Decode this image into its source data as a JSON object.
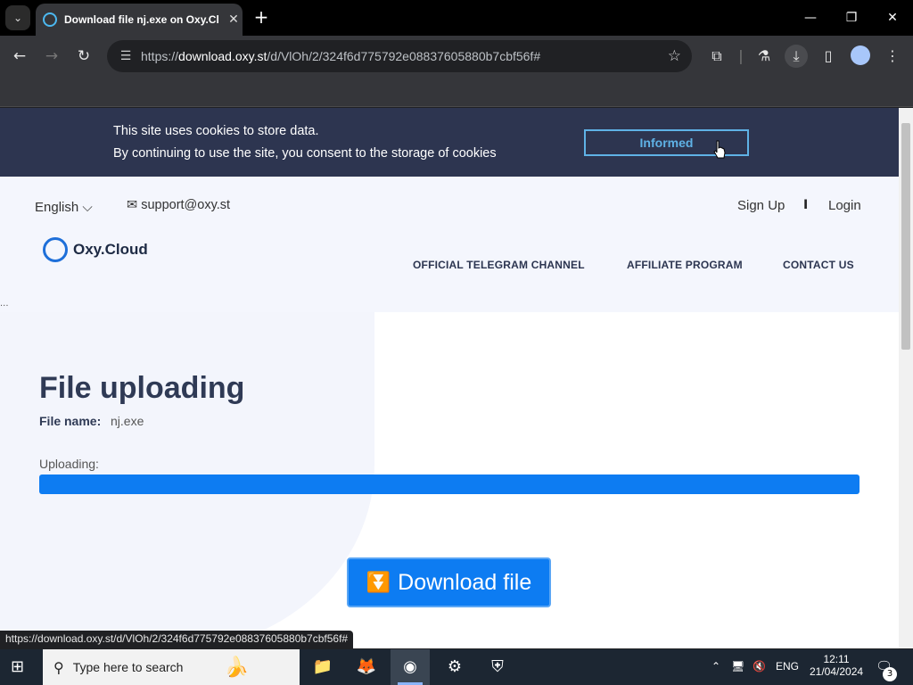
{
  "browser": {
    "tab_title": "Download file nj.exe on Oxy.Cl",
    "tab_close": "✕",
    "new_tab": "+",
    "url_prefix": "https://",
    "url_host": "download.oxy.st",
    "url_path": "/d/VlOh/2/324f6d775792e08837605880b7cbf56f#",
    "status_url": "https://download.oxy.st/d/VlOh/2/324f6d775792e08837605880b7cbf56f#"
  },
  "cookie_banner": {
    "line1": "This site uses cookies to store data.",
    "line2": "By continuing to use the site, you consent to the storage of cookies",
    "button_label": "Informed"
  },
  "header": {
    "language": "English",
    "support_email": "support@oxy.st",
    "signup": "Sign Up",
    "separator": "I",
    "login": "Login",
    "logo_text": "Oxy.Cloud",
    "nav": [
      "OFFICIAL TELEGRAM CHANNEL",
      "AFFILIATE PROGRAM",
      "CONTACT US"
    ]
  },
  "main": {
    "ellipsis": "...",
    "title": "File uploading",
    "filename_label": "File name:",
    "filename": "nj.exe",
    "uploading_label": "Uploading:",
    "progress": 1.0,
    "download_label": "Download file"
  },
  "taskbar": {
    "search_placeholder": "Type here to search",
    "language": "ENG",
    "time": "12:11",
    "date": "21/04/2024",
    "notifications_count": "3"
  },
  "colors": {
    "accent": "#0d7cf2",
    "cookie_bg": "#2d3550",
    "cookie_button": "#5fb2e6",
    "heading": "#2f3a55"
  }
}
